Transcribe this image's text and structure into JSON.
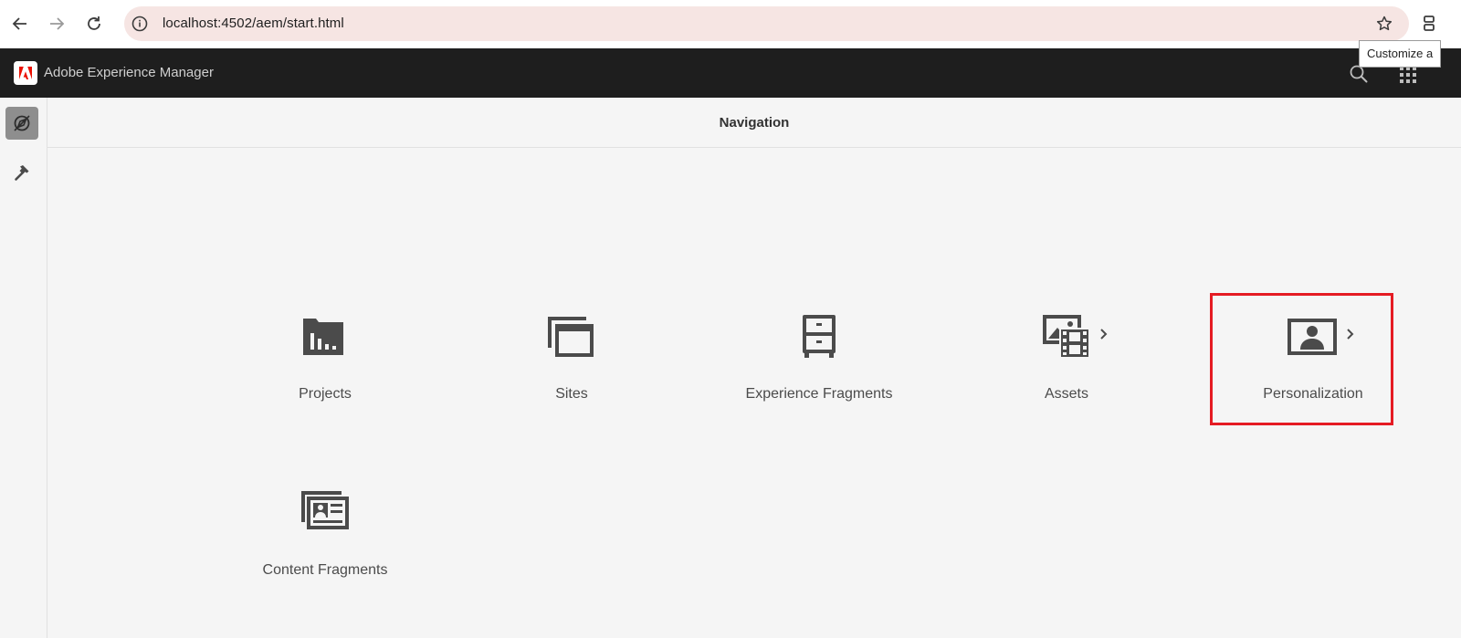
{
  "browser": {
    "url": "localhost:4502/aem/start.html",
    "tooltip": "Customize a"
  },
  "header": {
    "app_title": "Adobe Experience Manager"
  },
  "main": {
    "title": "Navigation",
    "tiles": [
      {
        "label": "Projects",
        "icon": "projects-icon"
      },
      {
        "label": "Sites",
        "icon": "sites-icon"
      },
      {
        "label": "Experience Fragments",
        "icon": "experience-fragments-icon"
      },
      {
        "label": "Assets",
        "icon": "assets-icon"
      },
      {
        "label": "Personalization",
        "icon": "personalization-icon"
      },
      {
        "label": "Content Fragments",
        "icon": "content-fragments-icon"
      }
    ]
  },
  "colors": {
    "header_bg": "#1e1e1e",
    "highlight": "#e51b23",
    "omnibox_bg": "#f6e5e3",
    "adobe_red": "#eb1000"
  }
}
